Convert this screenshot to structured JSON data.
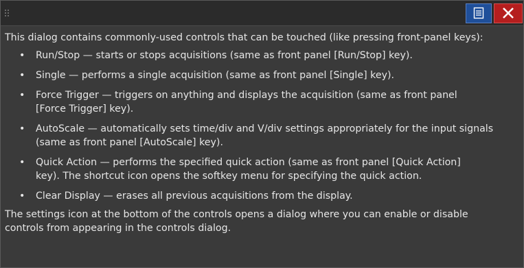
{
  "titlebar": {
    "help_icon": "document-icon",
    "close_icon": "close-x-icon",
    "help_color": "#1f4f9a",
    "close_color": "#b51e1e"
  },
  "body": {
    "intro": "This dialog contains commonly-used controls that can be touched (like pressing front-panel keys):",
    "bullet": "•",
    "items": [
      {
        "line1": "Run/Stop — starts or stops acquisitions (same as front panel [Run/Stop] key).",
        "line2": ""
      },
      {
        "line1": "Single — performs a single acquisition (same as front panel [Single] key).",
        "line2": ""
      },
      {
        "line1": "Force Trigger — triggers on anything and displays the acquisition (same as front panel",
        "line2": "[Force Trigger] key)."
      },
      {
        "line1": "AutoScale — automatically sets time/div and V/div settings appropriately for the input signals",
        "line2": "(same as front panel [AutoScale] key)."
      },
      {
        "line1": "Quick Action — performs the specified quick action (same as front panel [Quick Action]",
        "line2": "key). The shortcut icon opens the softkey menu for specifying the quick action."
      },
      {
        "line1": "Clear Display — erases all previous acquisitions from the display.",
        "line2": ""
      }
    ],
    "outro_line1": "The settings icon at the bottom of the controls opens a dialog where you can enable or disable",
    "outro_line2": "controls from appearing in the controls dialog."
  }
}
